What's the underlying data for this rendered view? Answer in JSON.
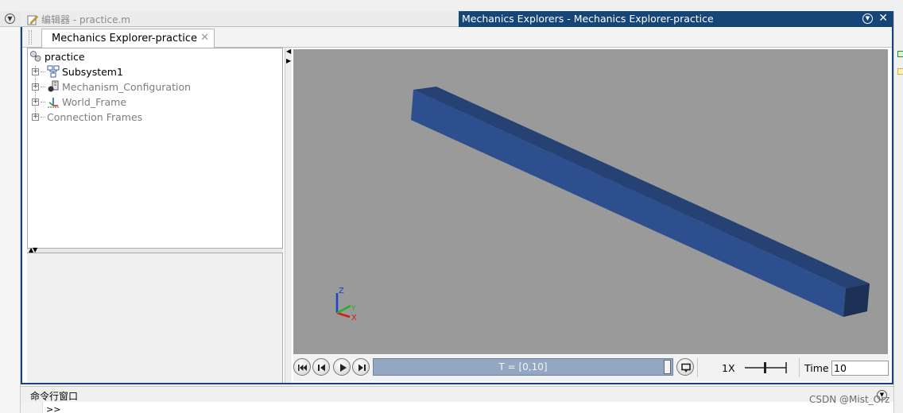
{
  "editor": {
    "title": "编辑器 - practice.m"
  },
  "mech_window": {
    "title": "Mechanics Explorers - Mechanics Explorer-practice"
  },
  "tab": {
    "label": "Mechanics Explorer-practice",
    "close": "✕"
  },
  "tree": {
    "root": "practice",
    "items": [
      {
        "label": "Subsystem1",
        "icon": "subsystem-icon",
        "dim": false
      },
      {
        "label": "Mechanism_Configuration",
        "icon": "mechanism-config-icon",
        "dim": true
      },
      {
        "label": "World_Frame",
        "icon": "world-frame-icon",
        "dim": true
      },
      {
        "label": "Connection Frames",
        "icon": "none",
        "dim": true
      }
    ]
  },
  "viewport": {
    "background": "#9a9a9a",
    "body_color": "#2e4f8e",
    "triad": {
      "z": "Z",
      "y": "Y",
      "x": "X"
    }
  },
  "playback": {
    "buttons": [
      "skip-to-start",
      "step-back",
      "play",
      "step-forward"
    ],
    "progress_label": "T = [0,10]",
    "progress": 1.0,
    "speed": "1X",
    "time_label": "Time",
    "time_value": "10"
  },
  "command_window": {
    "title": "命令行窗口",
    "prompt": ">>"
  },
  "watermark": "CSDN @Mist_Orz",
  "colors": {
    "accent": "#16457a",
    "progress": "#93a6c2"
  }
}
